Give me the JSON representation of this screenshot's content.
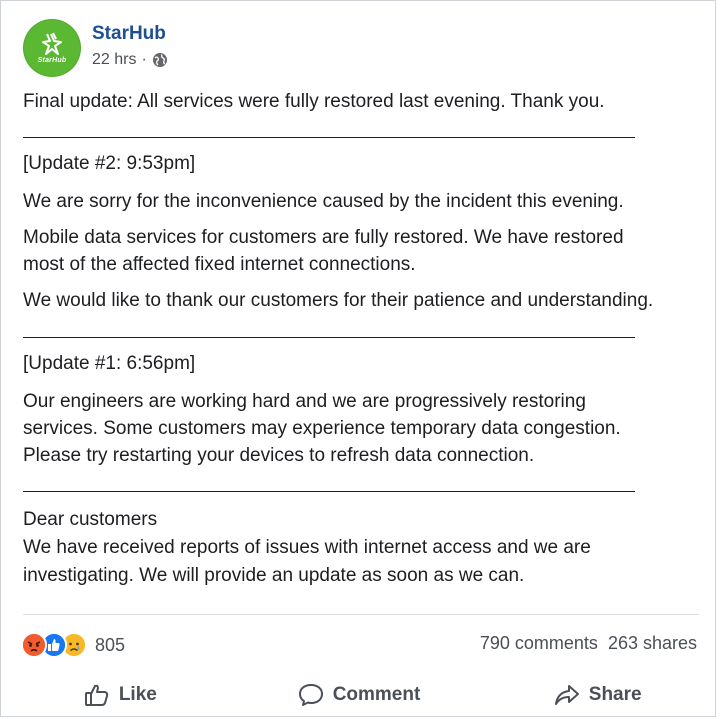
{
  "page": {
    "name": "StarHub",
    "time": "22 hrs",
    "separator": "·",
    "logo_text": "StarHub"
  },
  "post": {
    "final_update": "Final update: All services were fully restored last evening. Thank you.",
    "update2_heading": "[Update #2: 9:53pm]",
    "update2_p1": "We are sorry for the inconvenience caused by the incident this evening.",
    "update2_p2_line1": "Mobile data services for customers are fully restored. We have restored",
    "update2_p2_line2": "most of the affected fixed internet connections.",
    "update2_p3": "We would like to thank our customers for their patience and understanding.",
    "update1_heading": "[Update #1: 6:56pm]",
    "update1_line1": "Our engineers are working hard and we are progressively restoring",
    "update1_line2": "services. Some customers may experience temporary data congestion.",
    "update1_line3": "Please try restarting your devices to refresh data connection.",
    "dear_line1": "Dear customers",
    "dear_line2": "We have received reports of issues with internet access and we are",
    "dear_line3": "investigating. We will provide an update as soon as we can."
  },
  "engagement": {
    "reaction_icons": [
      "angry-reaction-icon",
      "like-reaction-icon",
      "sad-reaction-icon"
    ],
    "reaction_count": "805",
    "comments": "790 comments",
    "shares": "263 shares"
  },
  "actions": {
    "like": "Like",
    "comment": "Comment",
    "share": "Share"
  },
  "colors": {
    "page_name": "#1d4f91",
    "brand_green": "#5bb832",
    "like_blue": "#1877f2",
    "angry_orange": "#f25c2c",
    "sad_yellow": "#f7b928"
  }
}
